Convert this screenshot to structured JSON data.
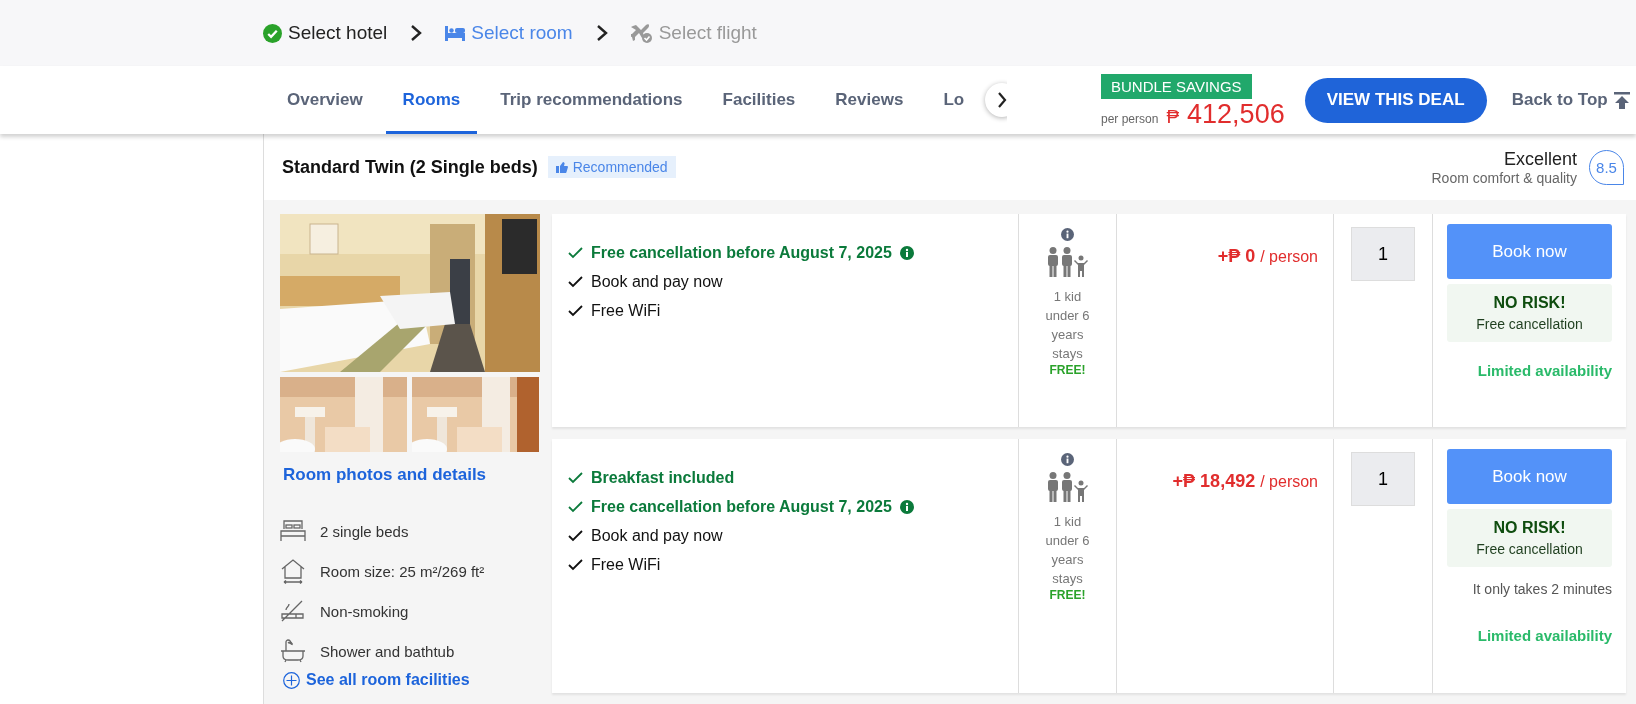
{
  "steps": [
    {
      "label": "Select hotel",
      "completed": true,
      "selected": false
    },
    {
      "label": "Select room",
      "completed": false,
      "selected": true
    },
    {
      "label": "Select flight",
      "completed": false,
      "selected": false
    }
  ],
  "nav": {
    "tabs": [
      {
        "label": "Overview",
        "selected": false
      },
      {
        "label": "Rooms",
        "selected": true
      },
      {
        "label": "Trip recommendations",
        "selected": false
      },
      {
        "label": "Facilities",
        "selected": false
      },
      {
        "label": "Reviews",
        "selected": false
      },
      {
        "label": "Lo",
        "selected": false
      }
    ],
    "deal": {
      "badge": "BUNDLE SAVINGS",
      "unit": "per person",
      "currency": "₱",
      "price": "412,506",
      "button": "VIEW THIS DEAL"
    },
    "back_to_top": "Back to Top"
  },
  "room": {
    "title": "Standard Twin (2 Single beds)",
    "tag": "Recommended",
    "rating_label": "Excellent",
    "rating_caption": "Room comfort & quality",
    "score": "8.5",
    "details_link": "Room photos and details",
    "facilities": [
      "2 single beds",
      "Room size: 25 m²/269 ft²",
      "Non-smoking",
      "Shower and bathtub"
    ],
    "all_facilities_link": "See all room facilities"
  },
  "offers": [
    {
      "features": [
        {
          "text": "Free cancellation before August 7, 2025",
          "highlight": true,
          "info": true
        },
        {
          "text": "Book and pay now",
          "highlight": false,
          "info": false
        },
        {
          "text": "Free WiFi",
          "highlight": false,
          "info": false
        }
      ],
      "occupancy": {
        "text": "1 kid under 6 years stays",
        "free": "FREE!"
      },
      "price": "+₱ 0",
      "unit": "/ person",
      "quantity": "1",
      "book": "Book now",
      "risk_title": "NO RISK!",
      "risk_text": "Free cancellation",
      "availability": "Limited availability"
    },
    {
      "features": [
        {
          "text": "Breakfast included",
          "highlight": true,
          "info": false
        },
        {
          "text": "Free cancellation before August 7, 2025",
          "highlight": true,
          "info": true
        },
        {
          "text": "Book and pay now",
          "highlight": false,
          "info": false
        },
        {
          "text": "Free WiFi",
          "highlight": false,
          "info": false
        }
      ],
      "occupancy": {
        "text": "1 kid under 6 years stays",
        "free": "FREE!"
      },
      "price": "+₱ 18,492",
      "unit": "/ person",
      "quantity": "1",
      "book": "Book now",
      "risk_title": "NO RISK!",
      "risk_text": "Free cancellation",
      "note": "It only takes 2 minutes",
      "availability": "Limited availability"
    }
  ]
}
